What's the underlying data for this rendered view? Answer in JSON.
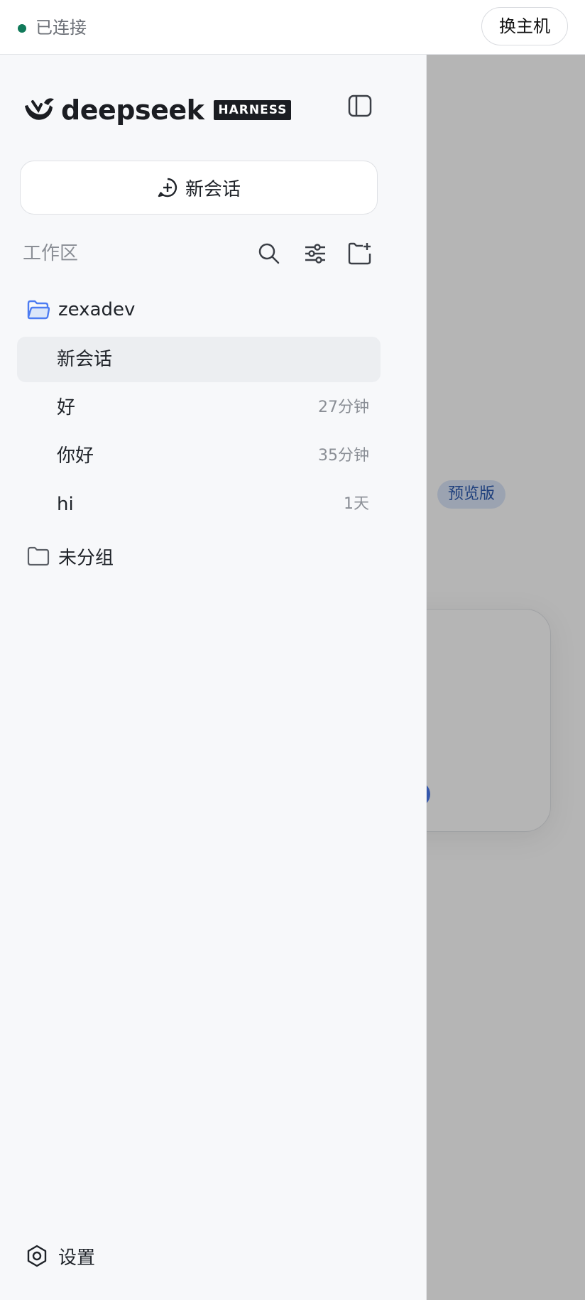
{
  "topbar": {
    "status_text": "已连接",
    "status_color": "#117a5a",
    "switch_host_label": "换主机"
  },
  "background": {
    "preview_badge": "预览版"
  },
  "sidebar": {
    "logo_text": "deepseek",
    "logo_badge": "HARNESS",
    "new_chat_label": "新会话",
    "workspace_label": "工作区",
    "workspace_actions": [
      "search-icon",
      "filter-sliders-icon",
      "new-folder-icon"
    ],
    "groups": [
      {
        "name": "zexadev",
        "icon": "folder-open-icon",
        "conversations": [
          {
            "title": "新会话",
            "time": "",
            "active": true
          },
          {
            "title": "好",
            "time": "27分钟",
            "active": false
          },
          {
            "title": "你好",
            "time": "35分钟",
            "active": false
          },
          {
            "title": "hi",
            "time": "1天",
            "active": false
          }
        ]
      },
      {
        "name": "未分组",
        "icon": "folder-icon",
        "conversations": []
      }
    ],
    "settings_label": "设置"
  },
  "colors": {
    "accent": "#4d7cf2",
    "sidebar_bg": "#f7f8fa",
    "active_item_bg": "#eceef1"
  }
}
